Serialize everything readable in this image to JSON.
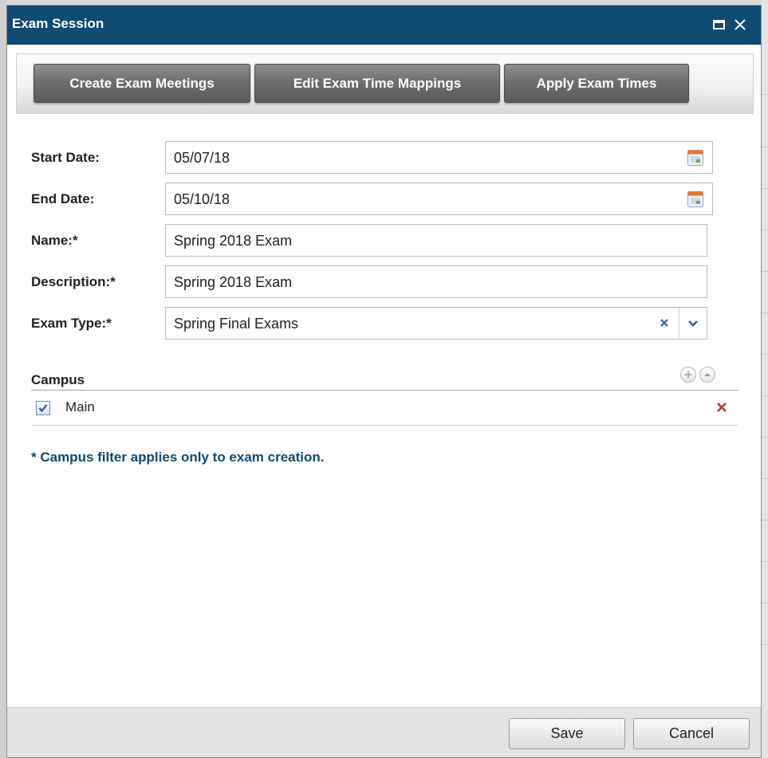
{
  "window": {
    "title": "Exam Session",
    "icons": {
      "maximize": "maximize-icon",
      "close": "close-icon"
    }
  },
  "toolbar": {
    "create_label": "Create Exam Meetings",
    "edit_label": "Edit Exam Time Mappings",
    "apply_label": "Apply Exam Times"
  },
  "form": {
    "start_date": {
      "label": "Start Date:",
      "value": "05/07/18",
      "icon": "calendar-icon"
    },
    "end_date": {
      "label": "End Date:",
      "value": "05/10/18",
      "icon": "calendar-icon"
    },
    "name": {
      "label": "Name:*",
      "value": "Spring 2018 Exam"
    },
    "description": {
      "label": "Description:*",
      "value": "Spring 2018 Exam"
    },
    "exam_type": {
      "label": "Exam Type:*",
      "value": "Spring Final Exams",
      "icons": [
        "clear-icon",
        "chevron-down-icon"
      ]
    }
  },
  "campus": {
    "header": "Campus",
    "icons": {
      "add": "plus-icon",
      "collapse": "chevron-up-icon",
      "remove": "remove-icon"
    },
    "items": [
      {
        "name": "Main",
        "checked": true
      }
    ]
  },
  "note": "* Campus filter applies only to exam creation.",
  "footer": {
    "save_label": "Save",
    "cancel_label": "Cancel"
  },
  "colors": {
    "titlebar": "#0f4a72",
    "note_text": "#0f4a72",
    "toolbar_button": "#6f6f6f",
    "remove_x": "#c0392b"
  }
}
